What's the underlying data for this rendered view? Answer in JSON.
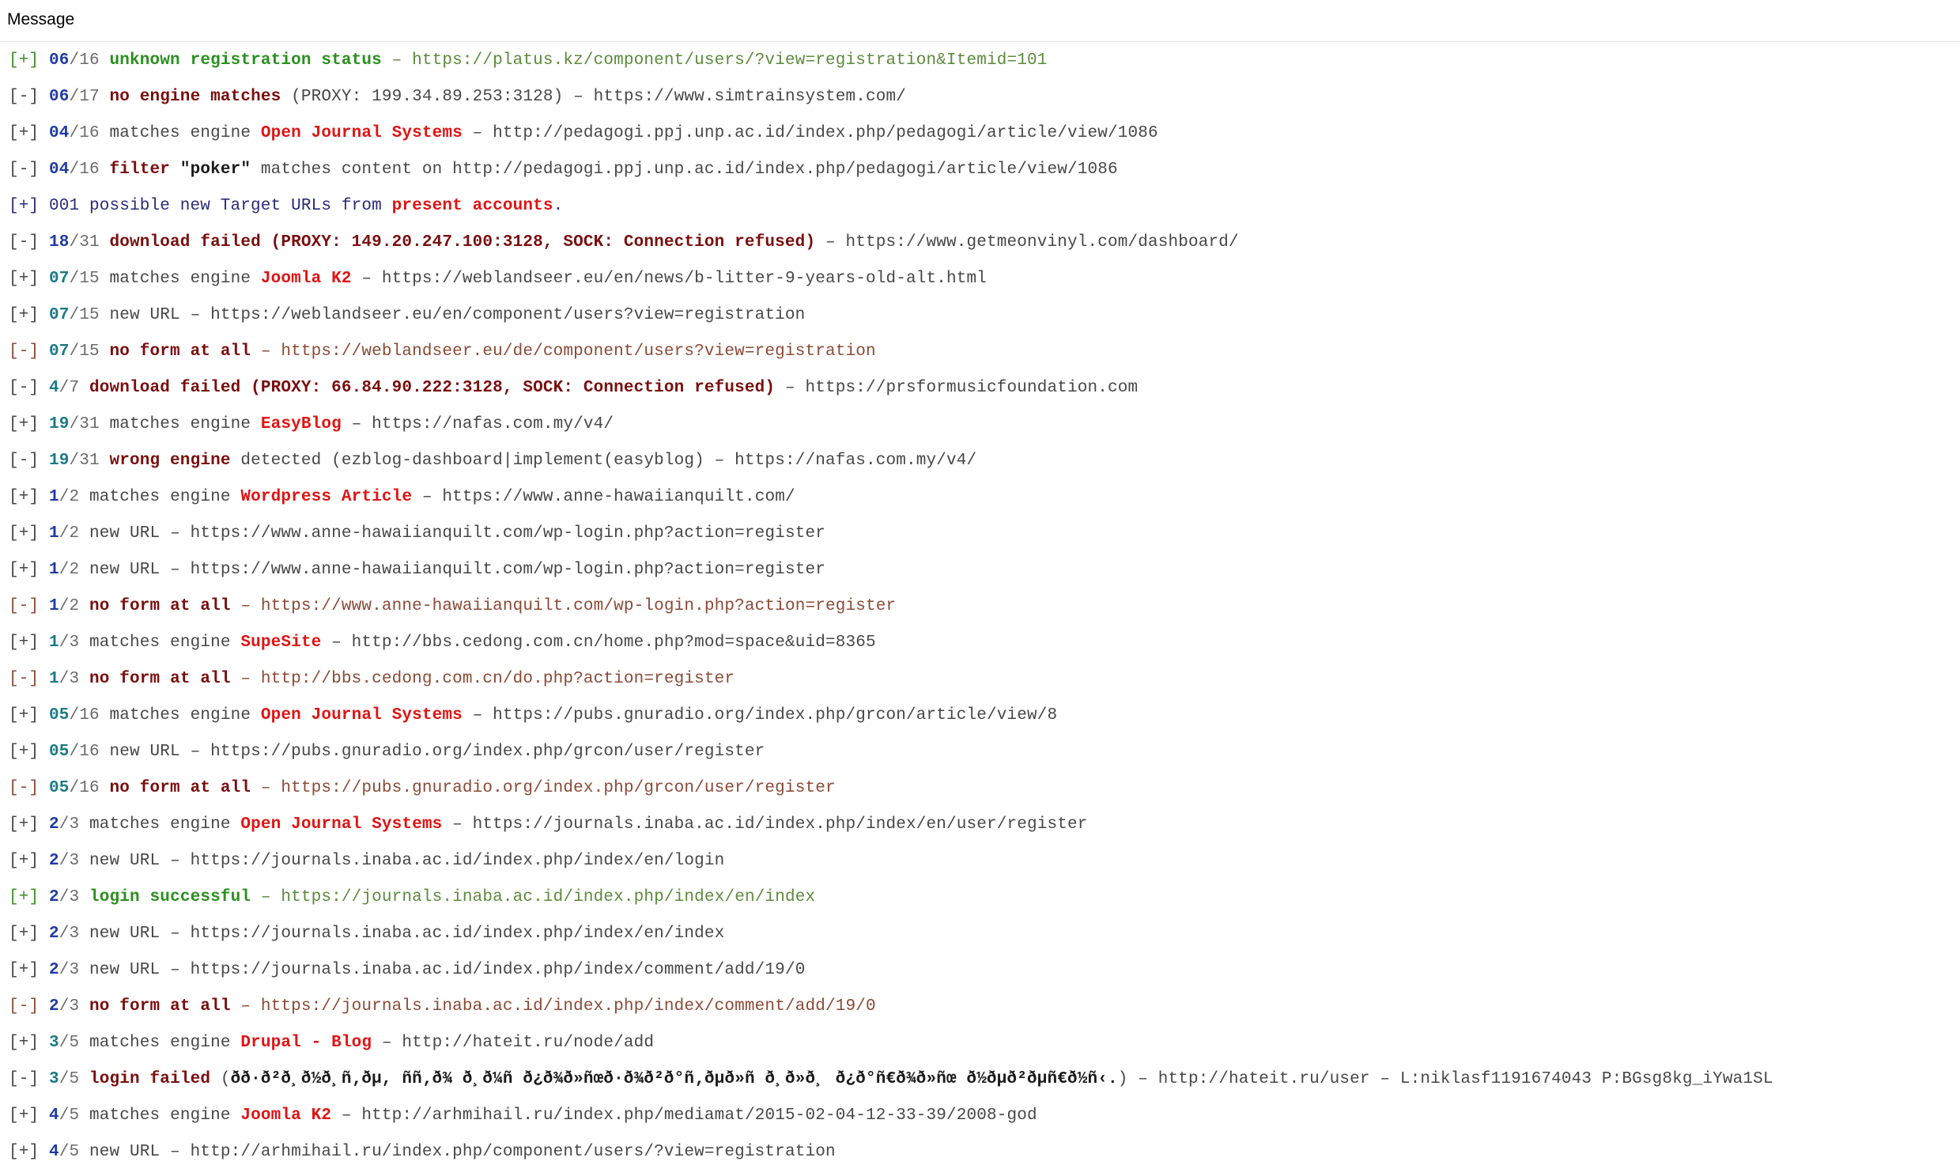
{
  "header": {
    "label": "Message"
  },
  "rows": [
    [
      [
        "[+] ",
        "c-green-plain"
      ],
      [
        "06",
        "c-num"
      ],
      [
        "/16 ",
        "c-total"
      ],
      [
        "unknown registration status",
        "c-green"
      ],
      [
        " – https://platus.kz/component/users/?view=registration&Itemid=101",
        "c-green-link"
      ]
    ],
    [
      [
        "[-] ",
        "c-gray"
      ],
      [
        "06",
        "c-num"
      ],
      [
        "/17 ",
        "c-total"
      ],
      [
        "no engine matches",
        "c-darkred"
      ],
      [
        " (PROXY: 199.34.89.253:3128) – https://www.simtrainsystem.com/",
        "c-gray"
      ]
    ],
    [
      [
        "[+] ",
        "c-gray"
      ],
      [
        "04",
        "c-num"
      ],
      [
        "/16 ",
        "c-total"
      ],
      [
        "matches engine ",
        "c-gray"
      ],
      [
        "Open Journal Systems",
        "c-red"
      ],
      [
        " – http://pedagogi.ppj.unp.ac.id/index.php/pedagogi/article/view/1086",
        "c-gray"
      ]
    ],
    [
      [
        "[-] ",
        "c-gray"
      ],
      [
        "04",
        "c-num"
      ],
      [
        "/16 ",
        "c-total"
      ],
      [
        "filter ",
        "c-darkred"
      ],
      [
        "\"poker\"",
        "c-black b"
      ],
      [
        " matches content on http://pedagogi.ppj.unp.ac.id/index.php/pedagogi/article/view/1086",
        "c-gray"
      ]
    ],
    [
      [
        "[+] ",
        "c-navy"
      ],
      [
        "001 possible new Target URLs from ",
        "c-navy"
      ],
      [
        "present accounts",
        "c-red"
      ],
      [
        ".",
        "c-navy"
      ]
    ],
    [
      [
        "[-] ",
        "c-gray"
      ],
      [
        "18",
        "c-num"
      ],
      [
        "/31 ",
        "c-total"
      ],
      [
        "download failed (PROXY: 149.20.247.100:3128, SOCK: Connection refused)",
        "c-darkred"
      ],
      [
        " – https://www.getmeonvinyl.com/dashboard/",
        "c-gray"
      ]
    ],
    [
      [
        "[+] ",
        "c-gray"
      ],
      [
        "07",
        "c-num-teal"
      ],
      [
        "/15 ",
        "c-total"
      ],
      [
        "matches engine ",
        "c-gray"
      ],
      [
        "Joomla K2",
        "c-red"
      ],
      [
        " – https://weblandseer.eu/en/news/b-litter-9-years-old-alt.html",
        "c-gray"
      ]
    ],
    [
      [
        "[+] ",
        "c-gray"
      ],
      [
        "07",
        "c-num-teal"
      ],
      [
        "/15 ",
        "c-total"
      ],
      [
        "new URL – https://weblandseer.eu/en/component/users?view=registration",
        "c-gray"
      ]
    ],
    [
      [
        "[-] ",
        "c-brownlink"
      ],
      [
        "07",
        "c-num-teal"
      ],
      [
        "/15 ",
        "c-total"
      ],
      [
        "no form at all",
        "c-darkred"
      ],
      [
        " – https://weblandseer.eu/de/component/users?view=registration",
        "c-brownlink"
      ]
    ],
    [
      [
        "[-] ",
        "c-gray"
      ],
      [
        "4",
        "c-num-teal"
      ],
      [
        "/7 ",
        "c-total"
      ],
      [
        "download failed (PROXY: 66.84.90.222:3128, SOCK: Connection refused)",
        "c-darkred"
      ],
      [
        " – https://prsformusicfoundation.com",
        "c-gray"
      ]
    ],
    [
      [
        "[+] ",
        "c-gray"
      ],
      [
        "19",
        "c-num-teal"
      ],
      [
        "/31 ",
        "c-total"
      ],
      [
        "matches engine ",
        "c-gray"
      ],
      [
        "EasyBlog",
        "c-red"
      ],
      [
        " – https://nafas.com.my/v4/",
        "c-gray"
      ]
    ],
    [
      [
        "[-] ",
        "c-gray"
      ],
      [
        "19",
        "c-num-teal"
      ],
      [
        "/31 ",
        "c-total"
      ],
      [
        "wrong engine",
        "c-darkred"
      ],
      [
        " detected (ezblog-dashboard|implement(easyblog) – https://nafas.com.my/v4/",
        "c-gray"
      ]
    ],
    [
      [
        "[+] ",
        "c-gray"
      ],
      [
        "1",
        "c-num"
      ],
      [
        "/2 ",
        "c-total"
      ],
      [
        "matches engine ",
        "c-gray"
      ],
      [
        "Wordpress Article",
        "c-red"
      ],
      [
        " – https://www.anne-hawaiianquilt.com/",
        "c-gray"
      ]
    ],
    [
      [
        "[+] ",
        "c-gray"
      ],
      [
        "1",
        "c-num"
      ],
      [
        "/2 ",
        "c-total"
      ],
      [
        "new URL – https://www.anne-hawaiianquilt.com/wp-login.php?action=register",
        "c-gray"
      ]
    ],
    [
      [
        "[+] ",
        "c-gray"
      ],
      [
        "1",
        "c-num"
      ],
      [
        "/2 ",
        "c-total"
      ],
      [
        "new URL – https://www.anne-hawaiianquilt.com/wp-login.php?action=register",
        "c-gray"
      ]
    ],
    [
      [
        "[-] ",
        "c-brownlink"
      ],
      [
        "1",
        "c-num"
      ],
      [
        "/2 ",
        "c-total"
      ],
      [
        "no form at all",
        "c-darkred"
      ],
      [
        " – https://www.anne-hawaiianquilt.com/wp-login.php?action=register",
        "c-brownlink"
      ]
    ],
    [
      [
        "[+] ",
        "c-gray"
      ],
      [
        "1",
        "c-num-teal"
      ],
      [
        "/3 ",
        "c-total"
      ],
      [
        "matches engine ",
        "c-gray"
      ],
      [
        "SupeSite",
        "c-red"
      ],
      [
        " – http://bbs.cedong.com.cn/home.php?mod=space&uid=8365",
        "c-gray"
      ]
    ],
    [
      [
        "[-] ",
        "c-brownlink"
      ],
      [
        "1",
        "c-num-teal"
      ],
      [
        "/3 ",
        "c-total"
      ],
      [
        "no form at all",
        "c-darkred"
      ],
      [
        " – http://bbs.cedong.com.cn/do.php?action=register",
        "c-brownlink"
      ]
    ],
    [
      [
        "[+] ",
        "c-gray"
      ],
      [
        "05",
        "c-num-teal"
      ],
      [
        "/16 ",
        "c-total"
      ],
      [
        "matches engine ",
        "c-gray"
      ],
      [
        "Open Journal Systems",
        "c-red"
      ],
      [
        " – https://pubs.gnuradio.org/index.php/grcon/article/view/8",
        "c-gray"
      ]
    ],
    [
      [
        "[+] ",
        "c-gray"
      ],
      [
        "05",
        "c-num-teal"
      ],
      [
        "/16 ",
        "c-total"
      ],
      [
        "new URL – https://pubs.gnuradio.org/index.php/grcon/user/register",
        "c-gray"
      ]
    ],
    [
      [
        "[-] ",
        "c-brownlink"
      ],
      [
        "05",
        "c-num-teal"
      ],
      [
        "/16 ",
        "c-total"
      ],
      [
        "no form at all",
        "c-darkred"
      ],
      [
        " – https://pubs.gnuradio.org/index.php/grcon/user/register",
        "c-brownlink"
      ]
    ],
    [
      [
        "[+] ",
        "c-gray"
      ],
      [
        "2",
        "c-num"
      ],
      [
        "/3 ",
        "c-total"
      ],
      [
        "matches engine ",
        "c-gray"
      ],
      [
        "Open Journal Systems",
        "c-red"
      ],
      [
        " – https://journals.inaba.ac.id/index.php/index/en/user/register",
        "c-gray"
      ]
    ],
    [
      [
        "[+] ",
        "c-gray"
      ],
      [
        "2",
        "c-num"
      ],
      [
        "/3 ",
        "c-total"
      ],
      [
        "new URL – https://journals.inaba.ac.id/index.php/index/en/login",
        "c-gray"
      ]
    ],
    [
      [
        "[+] ",
        "c-green-plain"
      ],
      [
        "2",
        "c-num"
      ],
      [
        "/3 ",
        "c-total"
      ],
      [
        "login successful",
        "c-green"
      ],
      [
        " – https://journals.inaba.ac.id/index.php/index/en/index",
        "c-green-link"
      ]
    ],
    [
      [
        "[+] ",
        "c-gray"
      ],
      [
        "2",
        "c-num"
      ],
      [
        "/3 ",
        "c-total"
      ],
      [
        "new URL – https://journals.inaba.ac.id/index.php/index/en/index",
        "c-gray"
      ]
    ],
    [
      [
        "[+] ",
        "c-gray"
      ],
      [
        "2",
        "c-num"
      ],
      [
        "/3 ",
        "c-total"
      ],
      [
        "new URL – https://journals.inaba.ac.id/index.php/index/comment/add/19/0",
        "c-gray"
      ]
    ],
    [
      [
        "[-] ",
        "c-brownlink"
      ],
      [
        "2",
        "c-num"
      ],
      [
        "/3 ",
        "c-total"
      ],
      [
        "no form at all",
        "c-darkred"
      ],
      [
        " – https://journals.inaba.ac.id/index.php/index/comment/add/19/0",
        "c-brownlink"
      ]
    ],
    [
      [
        "[+] ",
        "c-gray"
      ],
      [
        "3",
        "c-num-teal"
      ],
      [
        "/5 ",
        "c-total"
      ],
      [
        "matches engine ",
        "c-gray"
      ],
      [
        "Drupal - Blog",
        "c-red"
      ],
      [
        " – http://hateit.ru/node/add",
        "c-gray"
      ]
    ],
    [
      [
        "[-] ",
        "c-gray"
      ],
      [
        "3",
        "c-num-teal"
      ],
      [
        "/5 ",
        "c-total"
      ],
      [
        "login failed",
        "c-darkred"
      ],
      [
        " (",
        "c-gray"
      ],
      [
        "ðð·ð²ð¸ð½ð¸ñ‚ðµ, ññ‚ð¾ ð¸ð¼ñ ð¿ð¾ð»ñœð·ð¾ð²ð°ñ‚ðµð»ñ ð¸ð»ð¸ ð¿ð°ñ€ð¾ð»ñœ ð½ðµð²ðµñ€ð½ñ‹.",
        "c-black b"
      ],
      [
        ") – http://hateit.ru/user – L:niklasf1191674043 P:BGsg8kg_iYwa1SL",
        "c-gray"
      ]
    ],
    [
      [
        "[+] ",
        "c-gray"
      ],
      [
        "4",
        "c-num"
      ],
      [
        "/5 ",
        "c-total"
      ],
      [
        "matches engine ",
        "c-gray"
      ],
      [
        "Joomla K2",
        "c-red"
      ],
      [
        " – http://arhmihail.ru/index.php/mediamat/2015-02-04-12-33-39/2008-god",
        "c-gray"
      ]
    ],
    [
      [
        "[+] ",
        "c-gray"
      ],
      [
        "4",
        "c-num"
      ],
      [
        "/5 ",
        "c-total"
      ],
      [
        "new URL – http://arhmihail.ru/index.php/component/users/?view=registration",
        "c-gray"
      ]
    ]
  ]
}
